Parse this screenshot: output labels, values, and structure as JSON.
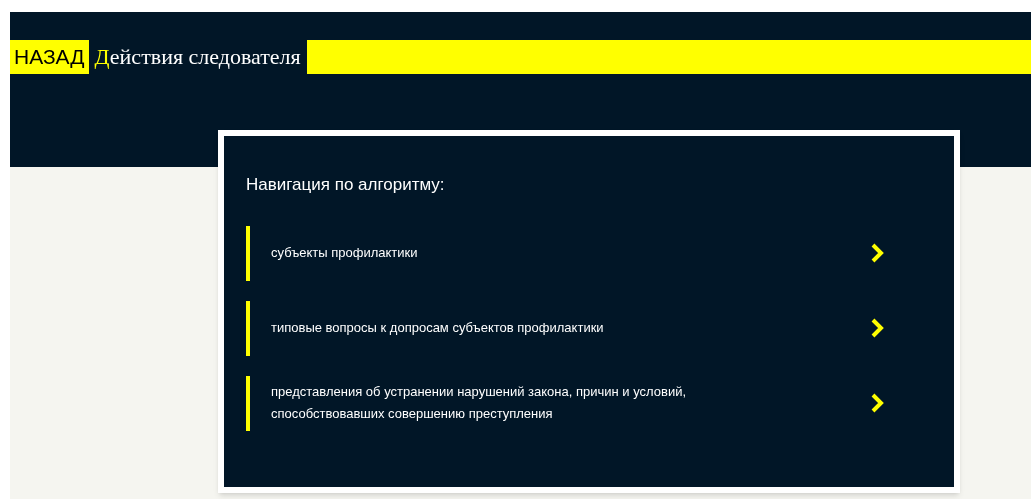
{
  "header": {
    "back_button": "НАЗАД",
    "title": "Действия следователя"
  },
  "navigation": {
    "heading": "Навигация по алгоритму:",
    "items": [
      {
        "label": "субъекты профилактики"
      },
      {
        "label": "типовые вопросы к допросам субъектов профилактики"
      },
      {
        "label": "представления об устранении нарушений закона, причин и условий, способствовавших совершению преступления"
      }
    ]
  }
}
